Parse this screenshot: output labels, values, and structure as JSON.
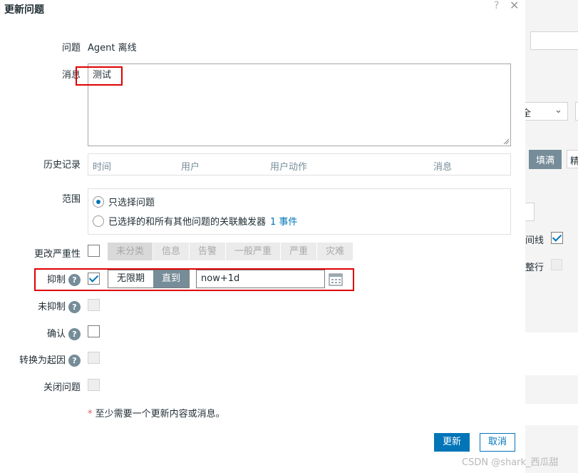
{
  "dialog": {
    "title": "更新问题",
    "help": "?",
    "close": "✕"
  },
  "form": {
    "problem_label": "问题",
    "problem_value": "Agent 离线",
    "message_label": "消息",
    "message_value": "测试",
    "history_label": "历史记录",
    "history_columns": [
      "时间",
      "用户",
      "用户动作",
      "消息"
    ],
    "scope_label": "范围",
    "scope_option1": "只选择问题",
    "scope_option2_prefix": "已选择的和所有其他问题的关联触发器",
    "scope_option2_count": "1 事件",
    "severity_label": "更改严重性",
    "severity_options": [
      "未分类",
      "信息",
      "告警",
      "一般严重",
      "严重",
      "灾难"
    ],
    "suppress_label": "抑制",
    "suppress_mode_indefinite": "无限期",
    "suppress_mode_until": "直到",
    "suppress_until_value": "now+1d",
    "unsuppress_label": "未抑制",
    "ack_label": "确认",
    "convert_cause_label": "转换为起因",
    "close_problem_label": "关闭问题",
    "hint_star": "*",
    "hint_text": "至少需要一个更新内容或消息。"
  },
  "buttons": {
    "update": "更新",
    "cancel": "取消"
  },
  "background": {
    "select_text": "全",
    "fill_button": "填满",
    "fill_button2": "精",
    "row1_label": "间线",
    "row2_label": "整行"
  },
  "watermark": "CSDN @shark_西瓜甜"
}
